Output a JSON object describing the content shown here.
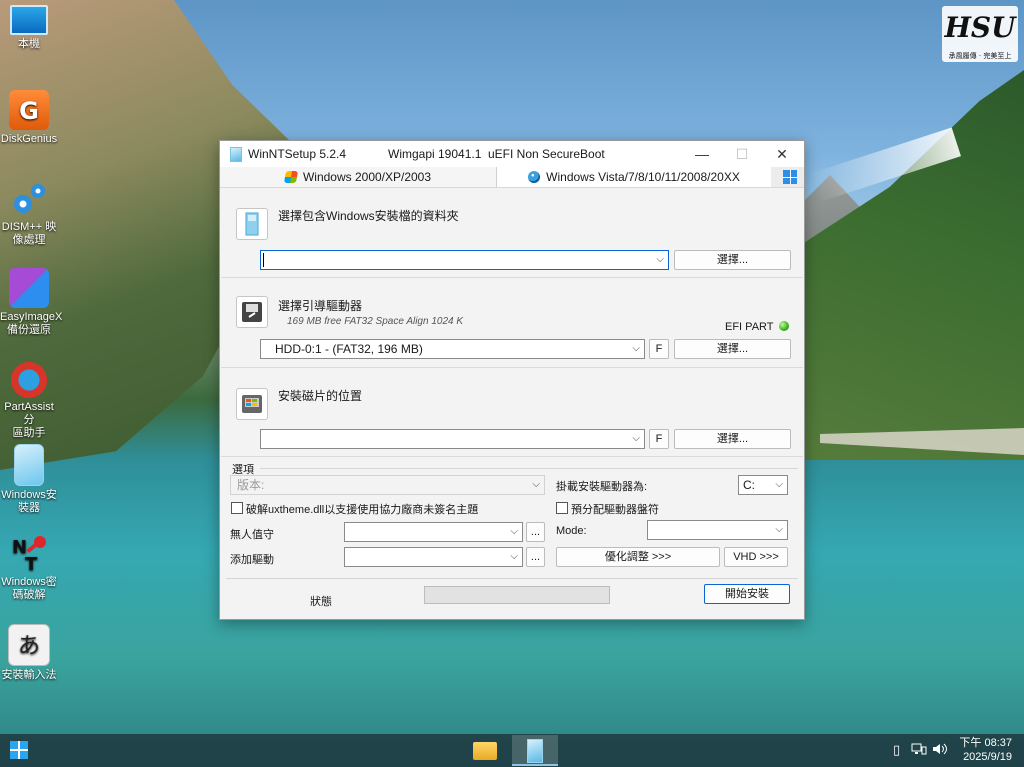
{
  "desktop": {
    "icons": [
      {
        "label": "本機",
        "icon": "this-pc-icon"
      },
      {
        "label": "DiskGenius",
        "icon": "diskgenius-icon"
      },
      {
        "label": "DISM++ 映\n像處理",
        "icon": "dism-icon"
      },
      {
        "label": "EasyImageX\n備份還原",
        "icon": "easyimagex-icon"
      },
      {
        "label": "PartAssist分\n區助手",
        "icon": "partassist-icon"
      },
      {
        "label": "Windows安\n裝器",
        "icon": "winntsetup-icon"
      },
      {
        "label": "Windows密\n碼破解",
        "icon": "nt-password-icon"
      },
      {
        "label": "安裝輸入法",
        "icon": "input-method-icon"
      }
    ],
    "logo": {
      "text": "HSU",
      "sub": "承風履傳 · 完美至上"
    }
  },
  "window": {
    "title": "WinNTSetup 5.2.4",
    "wimgapi": "Wimgapi 19041.1",
    "boot_mode": "uEFI Non SecureBoot",
    "tabs": {
      "xp": "Windows 2000/XP/2003",
      "vista": "Windows Vista/7/8/10/11/2008/20XX"
    },
    "source": {
      "title": "選擇包含Windows安裝檔的資料夾",
      "path": "",
      "select_label": "選擇..."
    },
    "boot": {
      "title": "選擇引導驅動器",
      "info": "169 MB free FAT32 Space Align 1024 K",
      "efi_label": "EFI PART",
      "drive": "HDD-0:1 -  (FAT32, 196 MB)",
      "f_label": "F",
      "select_label": "選擇..."
    },
    "install": {
      "title": "安裝磁片的位置",
      "drive": "",
      "f_label": "F",
      "select_label": "選擇..."
    },
    "options": {
      "heading": "選項",
      "edition_placeholder": "版本:",
      "uxtheme_label": "破解uxtheme.dll以支援使用協力廠商未簽名主題",
      "unattend_label": "無人值守",
      "add_driver_label": "添加驅動",
      "ellipsis": "...",
      "mount_label": "掛載安裝驅動器為:",
      "mount_drive": "C:",
      "prealloc_label": "預分配驅動器盤符",
      "mode_label": "Mode:",
      "tweaks_label": "優化調整 >>>",
      "vhd_label": "VHD >>>"
    },
    "footer": {
      "status_label": "狀態",
      "progress": 0,
      "install_label": "開始安裝"
    }
  },
  "taskbar": {
    "time": "下午 08:37",
    "date": "2025/9/19"
  }
}
